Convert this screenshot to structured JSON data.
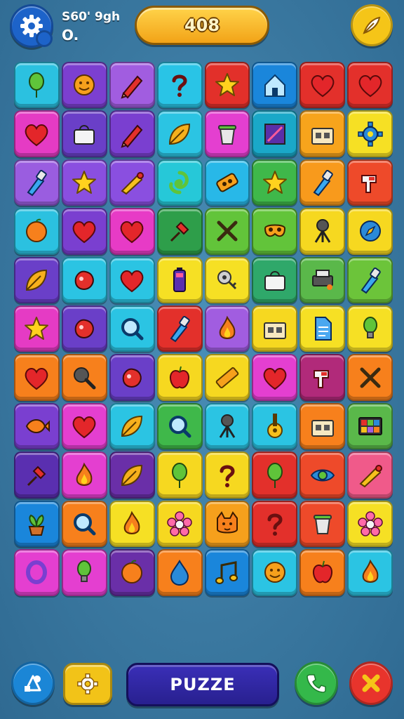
{
  "header": {
    "stat_line1": "S60' 9gh",
    "stat_line2": "O.",
    "score": "408"
  },
  "footer": {
    "puzzle_label": "PUZZE"
  },
  "colors": {
    "background": "#3c7ba3",
    "score_pill": "#f5b323",
    "puzzle_button": "#2e25a4"
  },
  "board": {
    "rows": 12,
    "cols": 8,
    "tiles": [
      [
        {
          "c": "#2bc1e0",
          "i": "balloon"
        },
        {
          "c": "#7c3fd0",
          "i": "face"
        },
        {
          "c": "#a15de0",
          "i": "pencil"
        },
        {
          "c": "#29c4e6",
          "i": "question"
        },
        {
          "c": "#e2302a",
          "i": "star"
        },
        {
          "c": "#1a86db",
          "i": "house"
        },
        {
          "c": "#e3302b",
          "i": "heart"
        },
        {
          "c": "#e3302b",
          "i": "heart"
        }
      ],
      [
        {
          "c": "#e53bc4",
          "i": "heart"
        },
        {
          "c": "#6a3fc8",
          "i": "bag"
        },
        {
          "c": "#7a3fd0",
          "i": "pencil"
        },
        {
          "c": "#2bc4e3",
          "i": "leaf"
        },
        {
          "c": "#e43fd0",
          "i": "cup"
        },
        {
          "c": "#1aa8c8",
          "i": "frame"
        },
        {
          "c": "#f7a41c",
          "i": "box"
        },
        {
          "c": "#f6e024",
          "i": "gear"
        }
      ],
      [
        {
          "c": "#9a5de0",
          "i": "brush"
        },
        {
          "c": "#8a4fe0",
          "i": "star"
        },
        {
          "c": "#8a4fe0",
          "i": "cone"
        },
        {
          "c": "#26c8d8",
          "i": "swirl"
        },
        {
          "c": "#28b8e8",
          "i": "chip"
        },
        {
          "c": "#3fb84a",
          "i": "star"
        },
        {
          "c": "#f89a1c",
          "i": "brush"
        },
        {
          "c": "#ee4a2a",
          "i": "tool"
        }
      ],
      [
        {
          "c": "#2bc1e0",
          "i": "orange"
        },
        {
          "c": "#7a3fd0",
          "i": "heart"
        },
        {
          "c": "#e73bc6",
          "i": "heart"
        },
        {
          "c": "#2e9e4a",
          "i": "pin"
        },
        {
          "c": "#62c43a",
          "i": "cross"
        },
        {
          "c": "#62c43a",
          "i": "mask"
        },
        {
          "c": "#f6d820",
          "i": "easel"
        },
        {
          "c": "#f6d820",
          "i": "compass"
        }
      ],
      [
        {
          "c": "#6a3fc8",
          "i": "leaf"
        },
        {
          "c": "#2bc4e3",
          "i": "blob"
        },
        {
          "c": "#2bc4e3",
          "i": "heart"
        },
        {
          "c": "#f6e024",
          "i": "battery"
        },
        {
          "c": "#f6e024",
          "i": "key"
        },
        {
          "c": "#2fa86a",
          "i": "bag"
        },
        {
          "c": "#5ab84a",
          "i": "printer"
        },
        {
          "c": "#6cc43a",
          "i": "brush"
        }
      ],
      [
        {
          "c": "#e53bc4",
          "i": "star"
        },
        {
          "c": "#6a3fc8",
          "i": "blob"
        },
        {
          "c": "#2bc4e3",
          "i": "magnifier"
        },
        {
          "c": "#e3302b",
          "i": "brush"
        },
        {
          "c": "#a15de0",
          "i": "flame"
        },
        {
          "c": "#f6d820",
          "i": "box"
        },
        {
          "c": "#f6e024",
          "i": "doc"
        },
        {
          "c": "#f6e024",
          "i": "bulb"
        }
      ],
      [
        {
          "c": "#f7801c",
          "i": "heart"
        },
        {
          "c": "#f7801c",
          "i": "pan"
        },
        {
          "c": "#6a3fc8",
          "i": "blob"
        },
        {
          "c": "#f6d820",
          "i": "apple"
        },
        {
          "c": "#f6d820",
          "i": "ruler"
        },
        {
          "c": "#e43fd0",
          "i": "heart"
        },
        {
          "c": "#b12a7a",
          "i": "tool"
        },
        {
          "c": "#f7801c",
          "i": "cross"
        }
      ],
      [
        {
          "c": "#7a3fd0",
          "i": "fish"
        },
        {
          "c": "#e43fd0",
          "i": "heart"
        },
        {
          "c": "#2bc4e3",
          "i": "leaf"
        },
        {
          "c": "#3fb84a",
          "i": "magnifier"
        },
        {
          "c": "#2bc4e3",
          "i": "easel"
        },
        {
          "c": "#2bc4e3",
          "i": "guitar"
        },
        {
          "c": "#f7801c",
          "i": "box"
        },
        {
          "c": "#5ab84a",
          "i": "grid"
        }
      ],
      [
        {
          "c": "#5a2fb0",
          "i": "pin"
        },
        {
          "c": "#e43fd0",
          "i": "flame"
        },
        {
          "c": "#6a2fa8",
          "i": "leaf"
        },
        {
          "c": "#f6d820",
          "i": "balloon"
        },
        {
          "c": "#f6d820",
          "i": "question"
        },
        {
          "c": "#e3302b",
          "i": "balloon"
        },
        {
          "c": "#ee4a2a",
          "i": "eye"
        },
        {
          "c": "#f05a8a",
          "i": "cone"
        }
      ],
      [
        {
          "c": "#1a86db",
          "i": "plant"
        },
        {
          "c": "#f7801c",
          "i": "magnifier"
        },
        {
          "c": "#f6e024",
          "i": "flame"
        },
        {
          "c": "#f6d820",
          "i": "flower"
        },
        {
          "c": "#f6a01c",
          "i": "cat"
        },
        {
          "c": "#e3302b",
          "i": "question"
        },
        {
          "c": "#ee4a2a",
          "i": "cup"
        },
        {
          "c": "#f6e024",
          "i": "flower"
        }
      ],
      [
        {
          "c": "#e43fd0",
          "i": "ring"
        },
        {
          "c": "#e43fd0",
          "i": "bulb"
        },
        {
          "c": "#6a2fa8",
          "i": "orange"
        },
        {
          "c": "#f7801c",
          "i": "drop"
        },
        {
          "c": "#1a86db",
          "i": "note"
        },
        {
          "c": "#2bc4e3",
          "i": "face"
        },
        {
          "c": "#f7801c",
          "i": "apple"
        },
        {
          "c": "#2bc4e3",
          "i": "flame"
        }
      ]
    ]
  }
}
